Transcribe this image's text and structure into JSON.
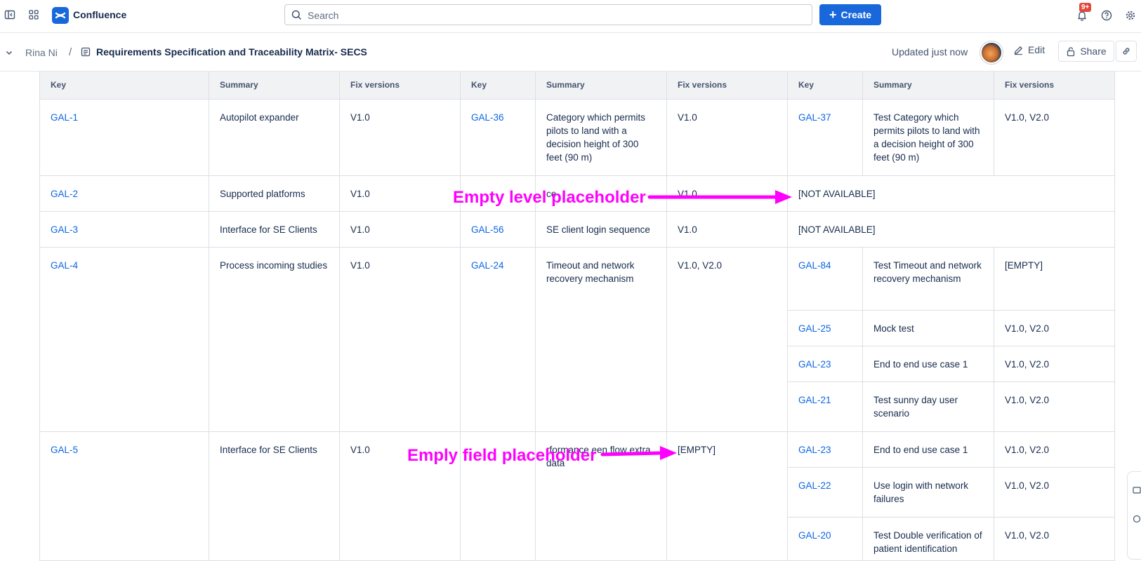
{
  "app": {
    "name": "Confluence"
  },
  "search": {
    "placeholder": "Search"
  },
  "create": {
    "label": "Create"
  },
  "notifications": {
    "badge": "9+"
  },
  "breadcrumb": {
    "user": "Rina Ni",
    "separator": "/"
  },
  "page": {
    "title": "Requirements Specification and Traceability Matrix- SECS",
    "updated": "Updated just now",
    "edit_label": "Edit",
    "share_label": "Share"
  },
  "table": {
    "headers": [
      "Key",
      "Summary",
      "Fix versions",
      "Key",
      "Summary",
      "Fix versions",
      "Key",
      "Summary",
      "Fix versions"
    ],
    "cells": [
      "GAL-1",
      "Autopilot expander",
      "V1.0",
      "GAL-36",
      "Category which permits pilots to land with a decision height of 300 feet (90 m)",
      "V1.0",
      "GAL-37",
      "Test Category which permits pilots to land with a decision height of 300 feet (90 m)",
      "V1.0, V2.0",
      "GAL-2",
      "Supported platforms",
      "V1.0",
      "",
      "ce",
      "V1.0",
      "[NOT AVAILABLE]",
      "GAL-3",
      "Interface for SE Clients",
      "V1.0",
      "GAL-56",
      "SE client login sequence",
      "V1.0",
      "[NOT AVAILABLE]",
      "GAL-4",
      "Process incoming studies",
      "V1.0",
      "GAL-24",
      "Timeout and network recovery mechanism",
      "V1.0, V2.0",
      "GAL-84",
      "Test Timeout and network recovery mechanism",
      "[EMPTY]",
      "GAL-25",
      "Mock test",
      "V1.0, V2.0",
      "GAL-23",
      "End to end use case 1",
      "V1.0, V2.0",
      "GAL-21",
      "Test sunny day user scenario",
      "V1.0, V2.0",
      "GAL-5",
      "Interface for SE Clients",
      "V1.0",
      "",
      "rformance een flow extra data",
      "[EMPTY]",
      "GAL-23",
      "End to end use case 1",
      "V1.0, V2.0",
      "GAL-22",
      "Use login with network failures",
      "V1.0, V2.0",
      "GAL-20",
      "Test Double verification of patient identification",
      "V1.0, V2.0"
    ]
  },
  "annotations": {
    "level": "Empty level placeholder",
    "field": "Emply field placeholder"
  },
  "colors": {
    "accent": "#1868db",
    "link": "#0c66e4",
    "annotation": "#ff00ff"
  },
  "icons": [
    "sidebar-toggle-icon",
    "app-switcher-icon",
    "search-icon",
    "plus-icon",
    "bell-icon",
    "help-icon",
    "gear-icon",
    "chevron-down-icon",
    "page-icon",
    "pencil-icon",
    "lock-icon",
    "link-icon"
  ]
}
